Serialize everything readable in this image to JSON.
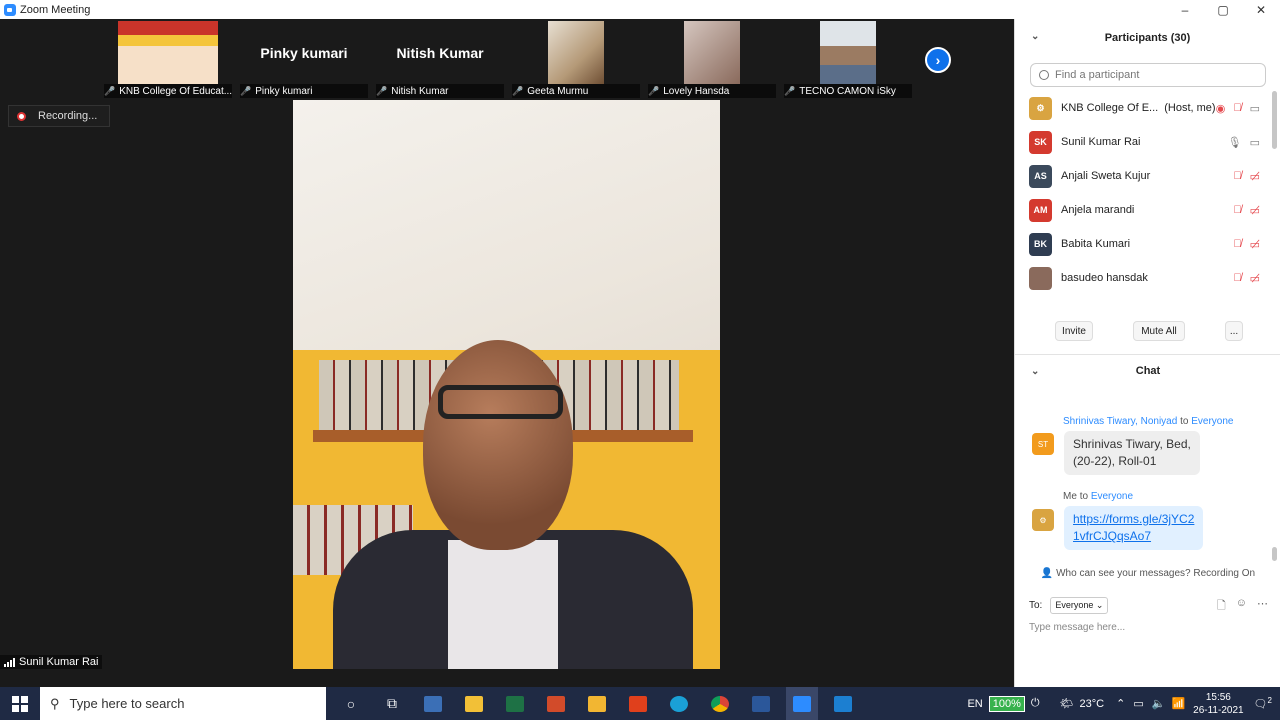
{
  "window": {
    "title": "Zoom Meeting",
    "controls": [
      "–",
      "▢",
      "✕"
    ]
  },
  "tiles": [
    {
      "label": "KNB College Of Educat...",
      "type": "video"
    },
    {
      "label": "Pinky kumari",
      "display_name": "Pinky kumari",
      "type": "name"
    },
    {
      "label": "Nitish Kumar",
      "display_name": "Nitish Kumar",
      "type": "name"
    },
    {
      "label": "Geeta Murmu",
      "type": "video"
    },
    {
      "label": "Lovely Hansda",
      "type": "video"
    },
    {
      "label": "TECNO CAMON iSky",
      "type": "video"
    }
  ],
  "recording": {
    "label": "Recording..."
  },
  "active_speaker": {
    "name": "Sunil Kumar Rai"
  },
  "participants": {
    "title": "Participants (30)",
    "search_placeholder": "Find a participant",
    "list": [
      {
        "name": "KNB College Of E...",
        "role": "(Host, me)",
        "initials": "",
        "color": "#d9a441"
      },
      {
        "name": "Sunil Kumar Rai",
        "initials": "SK",
        "color": "#d43a2f"
      },
      {
        "name": "Anjali Sweta Kujur",
        "initials": "AS",
        "color": "#3b4a5c"
      },
      {
        "name": "Anjela marandi",
        "initials": "AM",
        "color": "#d43a2f"
      },
      {
        "name": "Babita Kumari",
        "initials": "BK",
        "color": "#2f3d52"
      },
      {
        "name": "basudeo hansdak",
        "initials": "",
        "color": "#8a6a5c"
      }
    ],
    "buttons": {
      "invite": "Invite",
      "mute_all": "Mute All",
      "more": "..."
    }
  },
  "chat": {
    "title": "Chat",
    "messages": [
      {
        "sender": "Shrinivas Tiwary, Noniyad",
        "to_word": "to",
        "recipient": "Everyone",
        "avatar": "ST",
        "avatar_color": "#f29b1d",
        "text_line1": "Shrinivas Tiwary, Bed,",
        "text_line2": "(20-22), Roll-01"
      },
      {
        "sender": "Me",
        "to_word": "to",
        "recipient": "Everyone",
        "avatar": "",
        "avatar_color": "#d9a441",
        "text_line1": "https://forms.gle/3jYC2",
        "text_line2": "1vfrCJQqsAo7"
      }
    ],
    "who_can_see": "Who can see your messages? Recording On",
    "to_label": "To:",
    "to_value": "Everyone",
    "input_placeholder": "Type message here..."
  },
  "taskbar": {
    "search_placeholder": "Type here to search",
    "language": "EN",
    "battery": "100%",
    "temperature": "23°C",
    "time": "15:56",
    "date": "26-11-2021",
    "notifications": "2"
  }
}
